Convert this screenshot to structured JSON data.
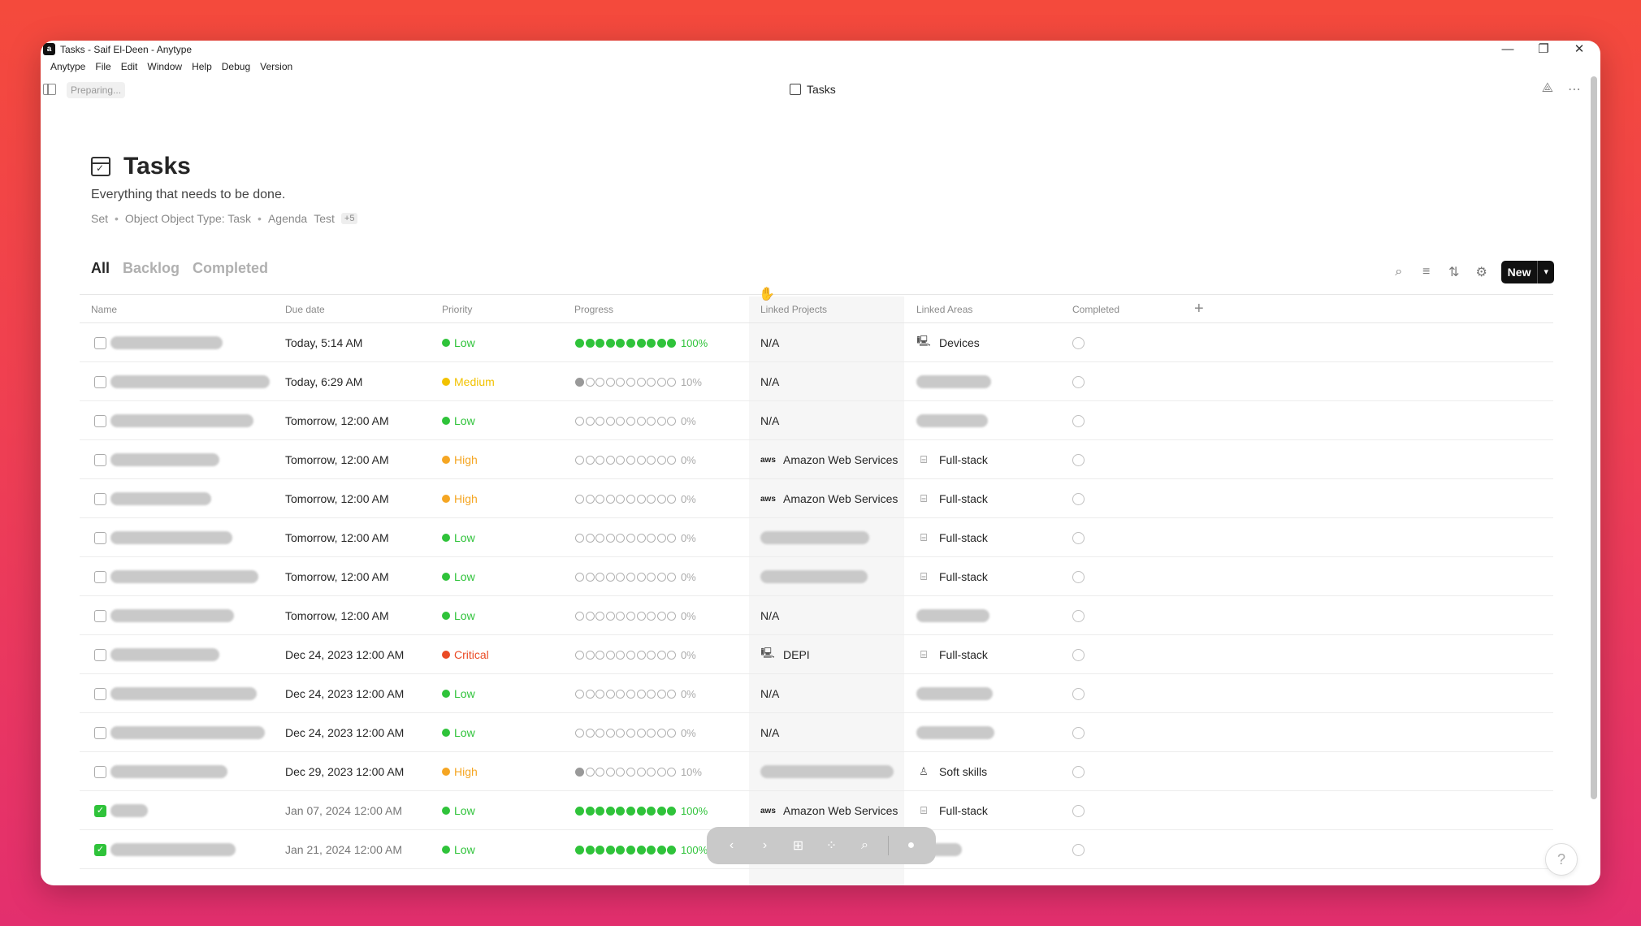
{
  "window": {
    "title": "Tasks - Saif El-Deen - Anytype",
    "logo": "a",
    "controls": {
      "minimize": "—",
      "restore": "❐",
      "close": "✕"
    }
  },
  "menu": [
    "Anytype",
    "File",
    "Edit",
    "Window",
    "Help",
    "Debug",
    "Version"
  ],
  "topbar": {
    "status": "Preparing...",
    "page_name": "Tasks",
    "icons": {
      "graph": "graph-icon",
      "more": "more-icon"
    }
  },
  "header": {
    "title": "Tasks",
    "description": "Everything that needs to be done.",
    "meta": {
      "set": "Set",
      "type": "Object Object Type: Task",
      "tag1": "Agenda",
      "tag2": "Test",
      "more": "+5"
    }
  },
  "tabs": [
    "All",
    "Backlog",
    "Completed"
  ],
  "toolbar": {
    "new_label": "New",
    "new_arrow": "▾"
  },
  "columns": {
    "name": "Name",
    "due": "Due date",
    "priority": "Priority",
    "progress": "Progress",
    "projects": "Linked Projects",
    "areas": "Linked Areas",
    "completed": "Completed",
    "add": "+"
  },
  "colors": {
    "low": "#2fc33a",
    "medium": "#f2c200",
    "high": "#f5a623",
    "critical": "#ea4b25",
    "accent": "#111111"
  },
  "rows": [
    {
      "checked": false,
      "due": "Today, 5:14 AM",
      "priority": "Low",
      "p": "low",
      "progress": 1.0,
      "pct": "100%",
      "project": "N/A",
      "project_icon": "",
      "area": "Devices",
      "area_icon": "devices-icon"
    },
    {
      "checked": false,
      "due": "Today, 6:29 AM",
      "priority": "Medium",
      "p": "medium",
      "progress": 0.1,
      "pct": "10%",
      "project": "N/A",
      "project_icon": "",
      "area": "",
      "area_icon": ""
    },
    {
      "checked": false,
      "due": "Tomorrow, 12:00 AM",
      "priority": "Low",
      "p": "low",
      "progress": 0,
      "pct": "0%",
      "project": "N/A",
      "project_icon": "",
      "area": "",
      "area_icon": ""
    },
    {
      "checked": false,
      "due": "Tomorrow, 12:00 AM",
      "priority": "High",
      "p": "high",
      "progress": 0,
      "pct": "0%",
      "project": "Amazon Web Services",
      "project_icon": "aws",
      "area": "Full-stack",
      "area_icon": "code-window-icon"
    },
    {
      "checked": false,
      "due": "Tomorrow, 12:00 AM",
      "priority": "High",
      "p": "high",
      "progress": 0,
      "pct": "0%",
      "project": "Amazon Web Services",
      "project_icon": "aws",
      "area": "Full-stack",
      "area_icon": "code-window-icon"
    },
    {
      "checked": false,
      "due": "Tomorrow, 12:00 AM",
      "priority": "Low",
      "p": "low",
      "progress": 0,
      "pct": "0%",
      "project": "",
      "project_icon": "",
      "area": "Full-stack",
      "area_icon": "code-window-icon"
    },
    {
      "checked": false,
      "due": "Tomorrow, 12:00 AM",
      "priority": "Low",
      "p": "low",
      "progress": 0,
      "pct": "0%",
      "project": "",
      "project_icon": "",
      "area": "Full-stack",
      "area_icon": "code-window-icon"
    },
    {
      "checked": false,
      "due": "Tomorrow, 12:00 AM",
      "priority": "Low",
      "p": "low",
      "progress": 0,
      "pct": "0%",
      "project": "N/A",
      "project_icon": "",
      "area": "",
      "area_icon": ""
    },
    {
      "checked": false,
      "due": "Dec 24, 2023 12:00 AM",
      "priority": "Critical",
      "p": "critical",
      "progress": 0,
      "pct": "0%",
      "project": "DEPI",
      "project_icon": "monitor-icon",
      "area": "Full-stack",
      "area_icon": "code-window-icon"
    },
    {
      "checked": false,
      "due": "Dec 24, 2023 12:00 AM",
      "priority": "Low",
      "p": "low",
      "progress": 0,
      "pct": "0%",
      "project": "N/A",
      "project_icon": "",
      "area": "",
      "area_icon": ""
    },
    {
      "checked": false,
      "due": "Dec 24, 2023 12:00 AM",
      "priority": "Low",
      "p": "low",
      "progress": 0,
      "pct": "0%",
      "project": "N/A",
      "project_icon": "",
      "area": "",
      "area_icon": ""
    },
    {
      "checked": false,
      "due": "Dec 29, 2023 12:00 AM",
      "priority": "High",
      "p": "high",
      "progress": 0.1,
      "pct": "10%",
      "project": "",
      "project_icon": "",
      "area": "Soft skills",
      "area_icon": "person-icon"
    },
    {
      "checked": true,
      "due": "Jan 07, 2024 12:00 AM",
      "priority": "Low",
      "p": "low",
      "progress": 1.0,
      "pct": "100%",
      "project": "Amazon Web Services",
      "project_icon": "aws",
      "area": "Full-stack",
      "area_icon": "code-window-icon"
    },
    {
      "checked": true,
      "due": "Jan 21, 2024 12:00 AM",
      "priority": "Low",
      "p": "low",
      "progress": 1.0,
      "pct": "100%",
      "project": "",
      "project_icon": "",
      "area": "",
      "area_icon": ""
    }
  ],
  "bottom_nav": {
    "back": "back-icon",
    "forward": "forward-icon",
    "add": "add-icon",
    "graph": "graph-icon",
    "search": "search-icon",
    "profile": "avatar"
  },
  "help": "?"
}
